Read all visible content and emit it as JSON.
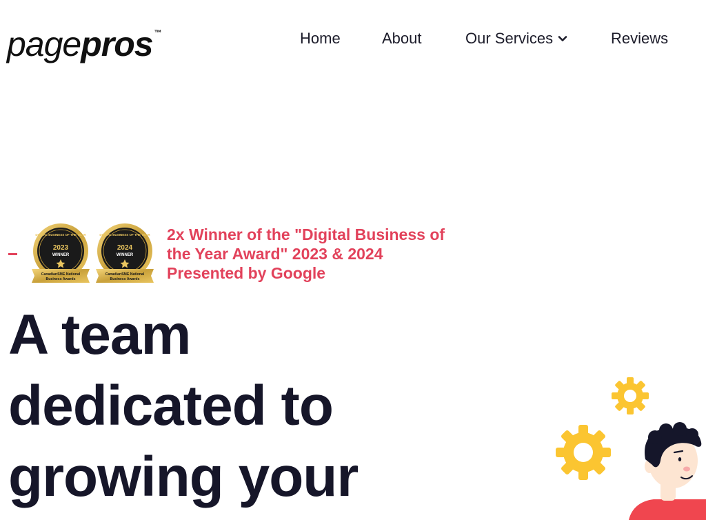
{
  "header": {
    "logo": {
      "light": "page",
      "bold": "pros",
      "tm": "™"
    },
    "nav": [
      {
        "label": "Home"
      },
      {
        "label": "About"
      },
      {
        "label": "Our Services"
      },
      {
        "label": "Reviews"
      }
    ]
  },
  "award": {
    "text_line1": "2x Winner of the \"Digital Business of",
    "text_line2": "the Year Award\" 2023 & 2024",
    "text_line3": "Presented by Google",
    "badges": [
      {
        "arc_text": "DIGITAL BUSINESS OF THE YEAR",
        "year": "2023",
        "label": "WINNER",
        "ribbon_line1": "CanadianSME National",
        "ribbon_line2": "Business Awards"
      },
      {
        "arc_text": "DIGITAL BUSINESS OF THE YEAR",
        "year": "2024",
        "label": "WINNER",
        "ribbon_line1": "CanadianSME National",
        "ribbon_line2": "Business Awards"
      }
    ]
  },
  "hero": {
    "line1": "A team",
    "line2": "dedicated to",
    "line3": "growing your"
  },
  "colors": {
    "accent": "#e2425b",
    "heading": "#161629",
    "gear": "#fbc531",
    "badge_gold": "#c9a13b",
    "badge_dark": "#1a1a1a"
  },
  "icons": {
    "services_dropdown": "chevron-down-icon",
    "award_badge": "award-medal-icon",
    "gear": "gear-icon"
  }
}
